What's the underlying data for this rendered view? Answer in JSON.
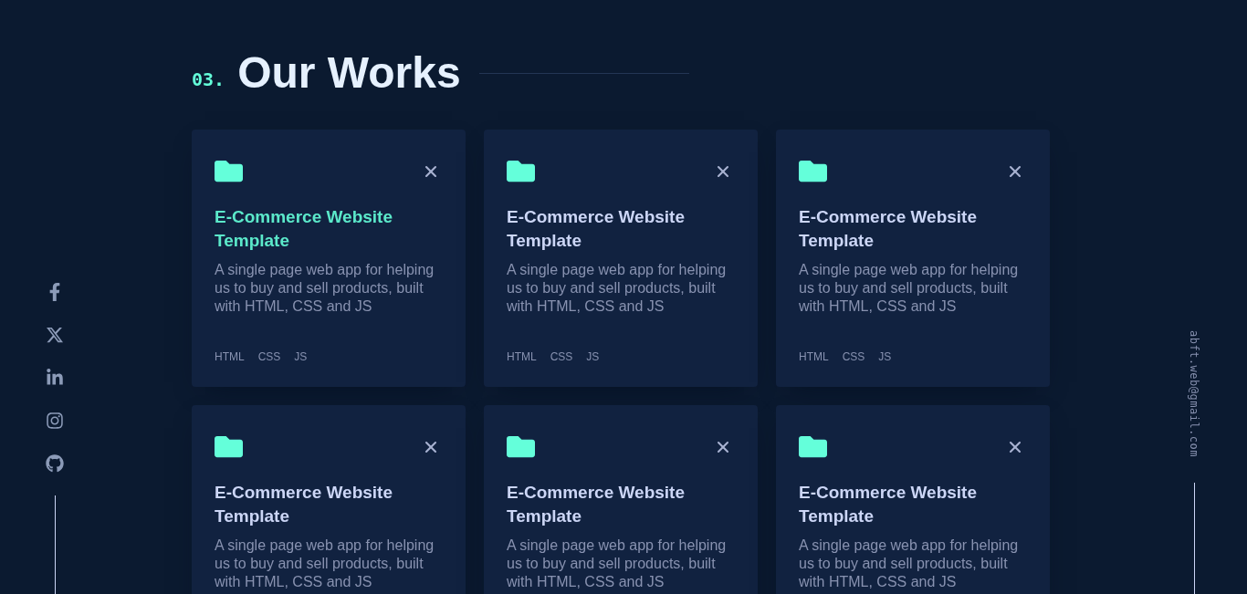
{
  "heading": {
    "number": "03.",
    "title": "Our Works"
  },
  "projects": [
    {
      "title": "E-Commerce Website Template",
      "highlighted": true,
      "description": "A single page web app for helping us to buy and sell products, built with HTML, CSS and JS",
      "tags": [
        "HTML",
        "CSS",
        "JS"
      ]
    },
    {
      "title": "E-Commerce Website Template",
      "highlighted": false,
      "description": "A single page web app for helping us to buy and sell products, built with HTML, CSS and JS",
      "tags": [
        "HTML",
        "CSS",
        "JS"
      ]
    },
    {
      "title": "E-Commerce Website Template",
      "highlighted": false,
      "description": "A single page web app for helping us to buy and sell products, built with HTML, CSS and JS",
      "tags": [
        "HTML",
        "CSS",
        "JS"
      ]
    },
    {
      "title": "E-Commerce Website Template",
      "highlighted": false,
      "description": "A single page web app for helping us to buy and sell products, built with HTML, CSS and JS"
    },
    {
      "title": "E-Commerce Website Template",
      "highlighted": false,
      "description": "A single page web app for helping us to buy and sell products, built with HTML, CSS and JS"
    },
    {
      "title": "E-Commerce Website Template",
      "highlighted": false,
      "description": "A single page web app for helping us to buy and sell products, built with HTML, CSS and JS"
    }
  ],
  "social_links": [
    {
      "kind": "facebook"
    },
    {
      "kind": "x"
    },
    {
      "kind": "linkedin"
    },
    {
      "kind": "instagram"
    },
    {
      "kind": "github"
    }
  ],
  "email": "abft.web@gmail.com"
}
